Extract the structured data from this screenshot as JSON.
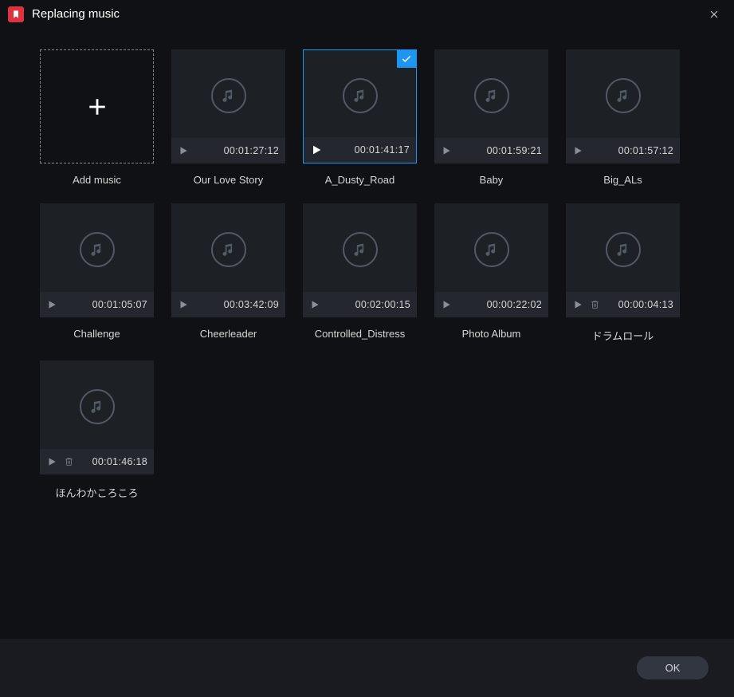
{
  "window": {
    "title": "Replacing music",
    "add_label": "Add music",
    "ok_label": "OK"
  },
  "tracks": [
    {
      "name": "Our Love Story",
      "duration": "00:01:27:12",
      "selected": false,
      "deletable": false
    },
    {
      "name": "A_Dusty_Road",
      "duration": "00:01:41:17",
      "selected": true,
      "deletable": false
    },
    {
      "name": "Baby",
      "duration": "00:01:59:21",
      "selected": false,
      "deletable": false
    },
    {
      "name": "Big_ALs",
      "duration": "00:01:57:12",
      "selected": false,
      "deletable": false
    },
    {
      "name": "Challenge",
      "duration": "00:01:05:07",
      "selected": false,
      "deletable": false
    },
    {
      "name": "Cheerleader",
      "duration": "00:03:42:09",
      "selected": false,
      "deletable": false
    },
    {
      "name": "Controlled_Distress",
      "duration": "00:02:00:15",
      "selected": false,
      "deletable": false
    },
    {
      "name": "Photo Album",
      "duration": "00:00:22:02",
      "selected": false,
      "deletable": false
    },
    {
      "name": "ドラムロール",
      "duration": "00:00:04:13",
      "selected": false,
      "deletable": true
    },
    {
      "name": "ほんわかころころ",
      "duration": "00:01:46:18",
      "selected": false,
      "deletable": true
    }
  ]
}
